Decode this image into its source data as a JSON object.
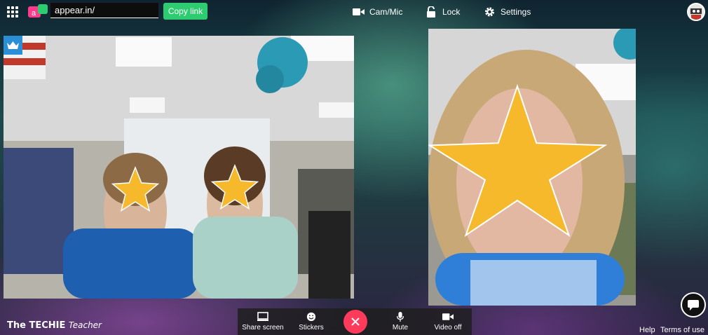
{
  "topbar": {
    "room_name": "appear.in/",
    "copy_link_label": "Copy link",
    "cam_mic_label": "Cam/Mic",
    "lock_label": "Lock",
    "settings_label": "Settings"
  },
  "icons": {
    "apps": "apps-grid-icon",
    "logo": "appear-in-logo-icon",
    "camera": "camera-icon",
    "lock": "lock-icon",
    "settings": "gear-icon",
    "crown": "crown-icon",
    "chat": "chat-bubble-icon"
  },
  "colors": {
    "accent_green": "#2ecc71",
    "leave_red": "#ff3b5c",
    "owner_badge": "#2b8fd6",
    "star_mask": "#f6b92c"
  },
  "bottombar": {
    "share_screen_label": "Share screen",
    "stickers_label": "Stickers",
    "mute_label": "Mute",
    "video_off_label": "Video off"
  },
  "footer": {
    "brand_main": "The TECHIE",
    "brand_small": "Teacher",
    "help_label": "Help",
    "terms_label": "Terms of use"
  }
}
